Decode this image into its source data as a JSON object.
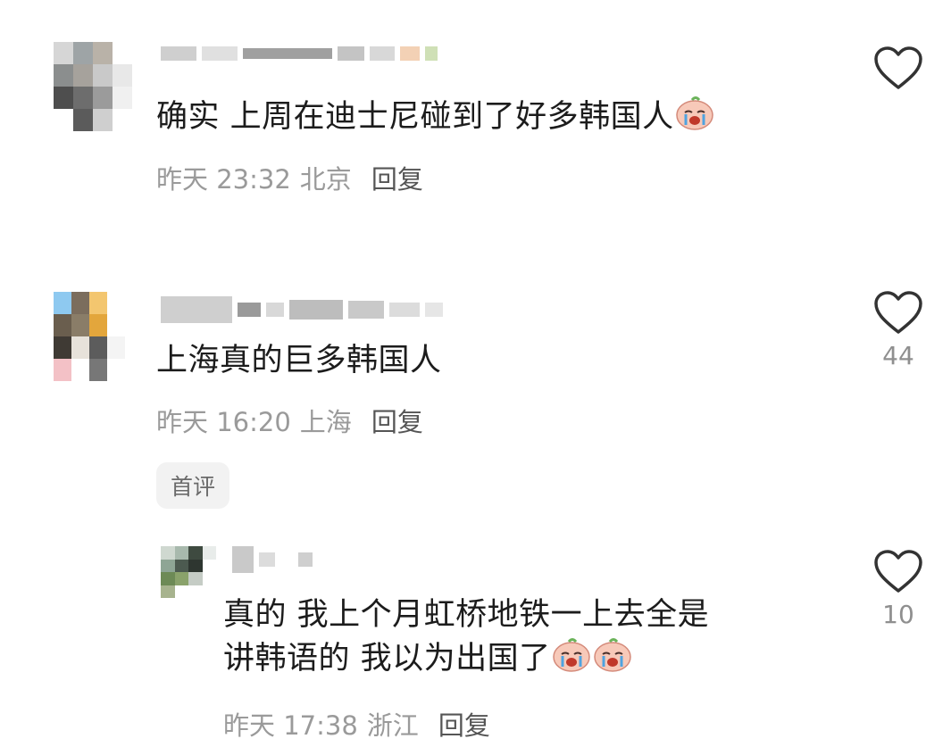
{
  "comments": [
    {
      "text": "确实 上周在迪士尼碰到了好多韩国人",
      "time": "昨天 23:32",
      "location": "北京",
      "reply": "回复",
      "likes": ""
    },
    {
      "text": "上海真的巨多韩国人",
      "time": "昨天 16:20",
      "location": "上海",
      "reply": "回复",
      "likes": "44",
      "tag": "首评"
    }
  ],
  "reply": {
    "text_line1": "真的 我上个月虹桥地铁一上去全是",
    "text_line2": "讲韩语的 我以为出国了",
    "time": "昨天 17:38",
    "location": "浙江",
    "reply": "回复",
    "likes": "10"
  },
  "icons": {
    "like": "heart-outline-icon",
    "emoji": "crying-face-emoji"
  },
  "colors": {
    "text": "#1c1c1c",
    "meta": "#9a9a9a",
    "heart": "#333333"
  }
}
